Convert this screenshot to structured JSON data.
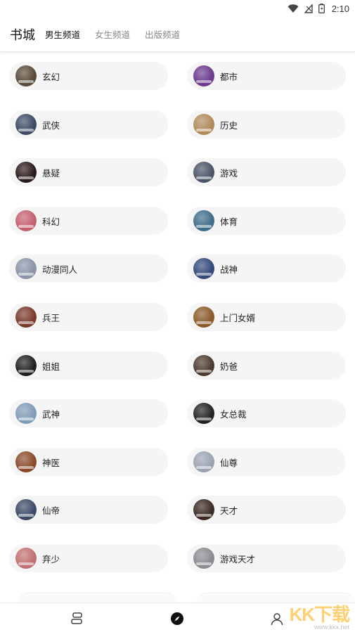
{
  "status_bar": {
    "time": "2:10",
    "icons": [
      "wifi-icon",
      "signal-icon",
      "battery-icon"
    ]
  },
  "header": {
    "title": "书城",
    "tabs": [
      {
        "label": "男生频道",
        "active": true
      },
      {
        "label": "女生频道",
        "active": false
      },
      {
        "label": "出版频道",
        "active": false
      }
    ]
  },
  "categories": [
    {
      "label": "玄幻",
      "cover_color": "#5a4a3a"
    },
    {
      "label": "都市",
      "cover_color": "#6b3a8c"
    },
    {
      "label": "武侠",
      "cover_color": "#3d4a66"
    },
    {
      "label": "历史",
      "cover_color": "#b08a5a"
    },
    {
      "label": "悬疑",
      "cover_color": "#2b1a1a"
    },
    {
      "label": "游戏",
      "cover_color": "#4a5566"
    },
    {
      "label": "科幻",
      "cover_color": "#c4606e"
    },
    {
      "label": "体育",
      "cover_color": "#3f6c8a"
    },
    {
      "label": "动漫同人",
      "cover_color": "#8a93a8"
    },
    {
      "label": "战神",
      "cover_color": "#334a7a"
    },
    {
      "label": "兵王",
      "cover_color": "#7a3a2a"
    },
    {
      "label": "上门女婿",
      "cover_color": "#8a5a2a"
    },
    {
      "label": "姐姐",
      "cover_color": "#1f1f1f"
    },
    {
      "label": "奶爸",
      "cover_color": "#4a3a30"
    },
    {
      "label": "武神",
      "cover_color": "#7f9bb8"
    },
    {
      "label": "女总裁",
      "cover_color": "#222222"
    },
    {
      "label": "神医",
      "cover_color": "#8a4a2a"
    },
    {
      "label": "仙尊",
      "cover_color": "#9aa4b0"
    },
    {
      "label": "仙帝",
      "cover_color": "#3a4a66"
    },
    {
      "label": "天才",
      "cover_color": "#3a2a22"
    },
    {
      "label": "弃少",
      "cover_color": "#c07070"
    },
    {
      "label": "游戏天才",
      "cover_color": "#8a8a90"
    }
  ],
  "bottom_nav": [
    {
      "icon": "bookshelf-icon"
    },
    {
      "icon": "compass-icon",
      "active": true
    },
    {
      "icon": "profile-icon"
    }
  ],
  "watermark": {
    "big": "KK下载",
    "small": "www.kkx.net"
  }
}
